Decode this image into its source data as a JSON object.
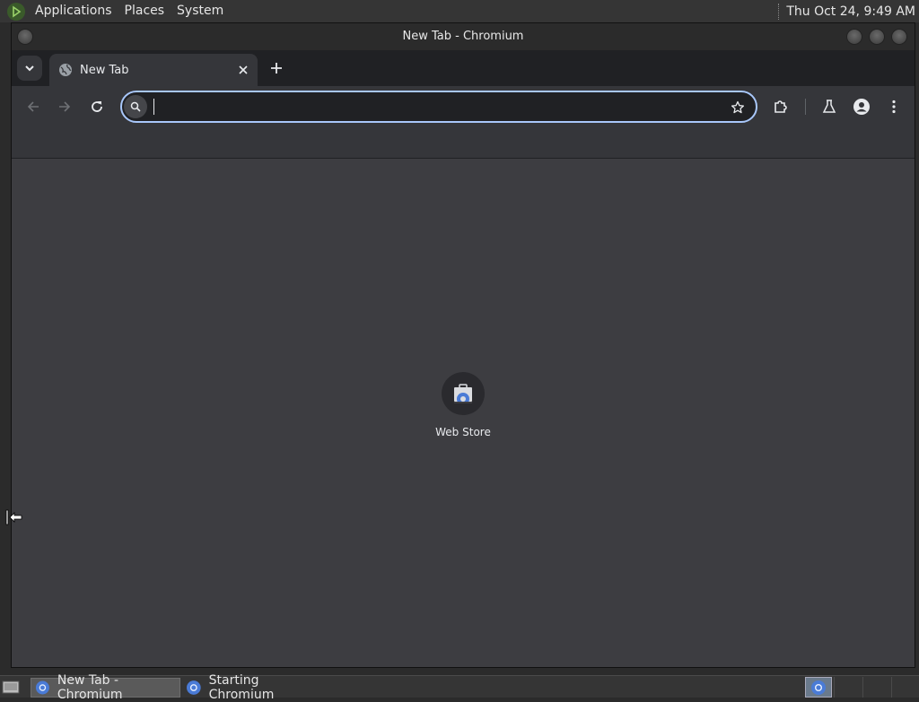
{
  "top_panel": {
    "menus": [
      "Applications",
      "Places",
      "System"
    ],
    "clock": "Thu Oct 24,  9:49 AM"
  },
  "window": {
    "title": "New Tab - Chromium"
  },
  "tabs": [
    {
      "title": "New Tab",
      "active": true
    }
  ],
  "omnibox": {
    "value": "",
    "placeholder": ""
  },
  "shortcuts": [
    {
      "label": "Web Store",
      "icon": "web-store-icon"
    }
  ],
  "taskbar": {
    "tasks": [
      {
        "label": "New Tab - Chromium",
        "active": true
      },
      {
        "label": "Starting Chromium",
        "active": false
      }
    ]
  },
  "colors": {
    "accent": "#a8c7fa",
    "toolbar": "#35363a",
    "content_bg": "#3d3d41"
  }
}
